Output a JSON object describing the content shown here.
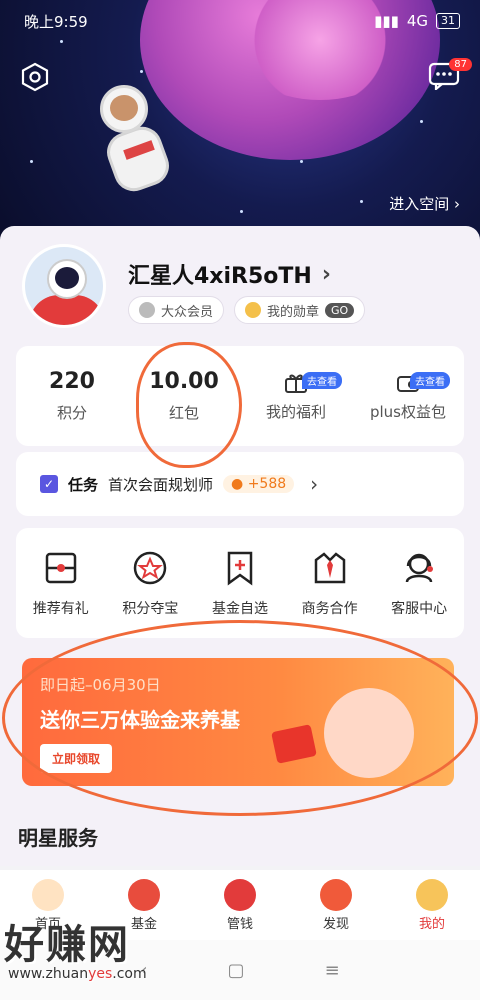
{
  "status_bar": {
    "time": "晚上9:59",
    "network": "4G",
    "battery": "31"
  },
  "header": {
    "enter_space": "进入空间",
    "message_badge": "87"
  },
  "profile": {
    "username": "汇星人4xiR5oTH",
    "membership": "大众会员",
    "medals": "我的勋章",
    "medals_go": "GO"
  },
  "stats": [
    {
      "value": "220",
      "label": "积分"
    },
    {
      "value": "10.00",
      "label": "红包"
    },
    {
      "label": "我的福利",
      "tag": "去查看",
      "icon": "gift-icon"
    },
    {
      "label": "plus权益包",
      "tag": "去查看",
      "icon": "wallet-icon"
    }
  ],
  "task": {
    "title": "任务",
    "desc": "首次会面规划师",
    "reward": "+588"
  },
  "services": [
    {
      "label": "推荐有礼",
      "icon": "envelope-icon"
    },
    {
      "label": "积分夺宝",
      "icon": "star-badge-icon"
    },
    {
      "label": "基金自选",
      "icon": "bookmark-plus-icon"
    },
    {
      "label": "商务合作",
      "icon": "suit-tie-icon"
    },
    {
      "label": "客服中心",
      "icon": "headset-icon"
    }
  ],
  "banner": {
    "date": "即日起–06月30日",
    "headline": "送你三万体验金来养基",
    "cta": "立即领取"
  },
  "section": {
    "title": "明星服务"
  },
  "tabbar": [
    {
      "label": "首页",
      "icon": "home-icon"
    },
    {
      "label": "基金",
      "icon": "fund-icon"
    },
    {
      "label": "管钱",
      "icon": "money-bag-icon"
    },
    {
      "label": "发现",
      "icon": "discover-icon"
    },
    {
      "label": "我的",
      "icon": "lion-icon"
    }
  ],
  "watermark": {
    "big": "好赚网",
    "url_pre": "www.zhuan",
    "url_yes": "yes",
    "url_post": ".com"
  }
}
